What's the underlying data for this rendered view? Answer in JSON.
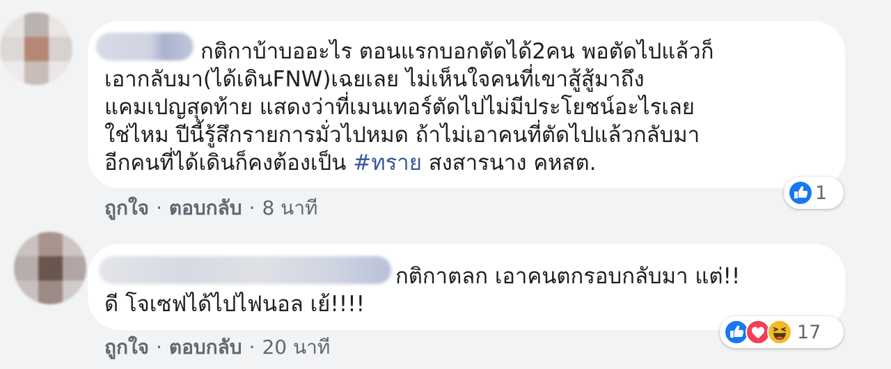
{
  "comments": [
    {
      "lines": [
        "กติกาบ้าบออะไร ตอนแรกบอกตัดได้2คน พอตัดไปแล้วก็",
        "เอากลับมา(ได้เดินFNW)เฉยเลย ไม่เห็นใจคนที่เขาสู้สู้มาถึง",
        "แคมเปญสุดท้าย แสดงว่าที่เมนเทอร์ตัดไปไม่มีประโยชน์อะไรเลย",
        "ใช่ไหม ปีนี้รู้สึกรายการมั่วไปหมด ถ้าไม่เอาคนที่ตัดไปแล้วกลับมา"
      ],
      "last_line_prefix": "อีกคนที่ได้เดินก็คงต้องเป็น ",
      "hashtag": "#ทราย",
      "last_line_suffix": " สงสารนาง คหสต.",
      "like_label": "ถูกใจ",
      "reply_label": "ตอบกลับ",
      "time": "8 นาที",
      "reaction_icons": [
        "like-icon"
      ],
      "reaction_count": "1"
    },
    {
      "lines": [
        "กติกาตลก เอาคนตกรอบกลับมา แต่!!",
        "ดี โจเซฟได้ไปไฟนอล เย้!!!!"
      ],
      "like_label": "ถูกใจ",
      "reply_label": "ตอบกลับ",
      "time": "20 นาที",
      "reaction_icons": [
        "like-icon",
        "love-icon",
        "haha-icon"
      ],
      "reaction_count": "17"
    }
  ],
  "separator": "·",
  "colors": {
    "background": "#f2f3f5",
    "bubble": "#ffffff",
    "text": "#1c1e21",
    "hashtag": "#385898",
    "meta": "#606770",
    "like_blue": "#1877f2",
    "love_red": "#f33e58",
    "haha_yellow": "#f7b928"
  }
}
